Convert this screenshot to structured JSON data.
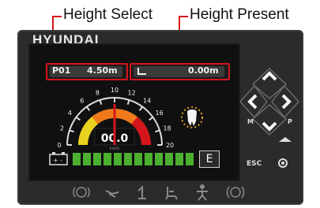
{
  "callouts": {
    "left": "Height Select",
    "right": "Height Present"
  },
  "brand": "HYUNDAI",
  "height_select": {
    "preset": "P01",
    "value": "4.50m"
  },
  "height_present": {
    "value": "0.00m"
  },
  "gauge": {
    "ticks": [
      "0",
      "2",
      "4",
      "6",
      "8",
      "10",
      "12",
      "14",
      "16",
      "18",
      "20"
    ],
    "readout": "00.0",
    "unit": "km/h",
    "needle_value": 10
  },
  "battery": {
    "segments_total": 12,
    "segments_lit": 12
  },
  "e_indicator": "E",
  "side_buttons": {
    "m_label": "M",
    "p_label": "P",
    "esc_label": "ESC"
  },
  "colors": {
    "frame_red": "#d4151c",
    "panel": "#2b2b2b",
    "battery_green": "#4caf30",
    "gauge_orange": "#f07a1a"
  },
  "icons": [
    "arrow-up-icon",
    "arrow-left-icon",
    "arrow-right-icon",
    "arrow-down-icon",
    "horn-icon",
    "settings-icon",
    "swing-icon",
    "wrench-icon",
    "boom-icon",
    "seat-icon",
    "person-icon",
    "warning-circle-icon"
  ]
}
